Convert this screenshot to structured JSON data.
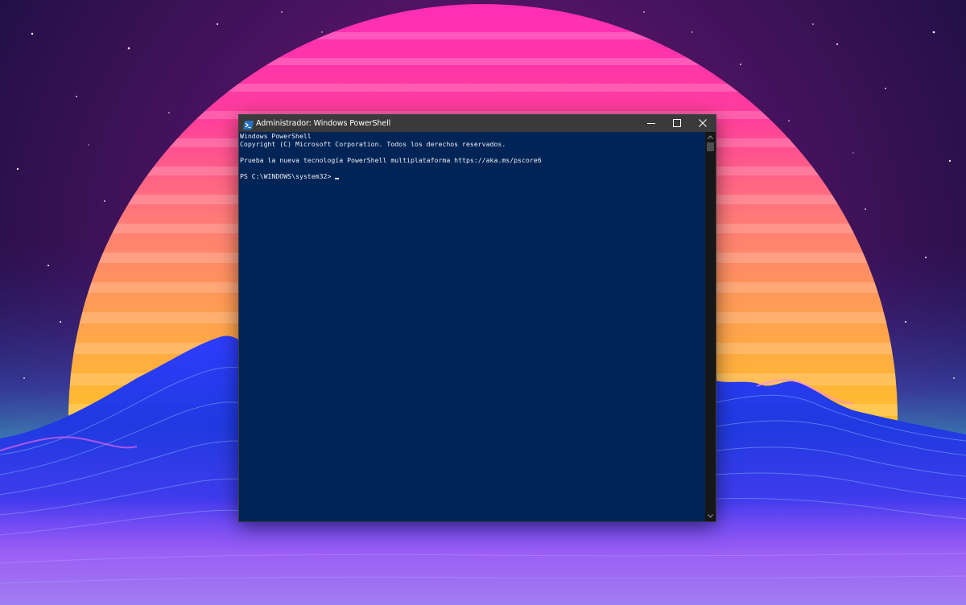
{
  "desktop": {
    "wallpaper": "retrowave-sunset-mountains",
    "colors": {
      "sky_top": "#3c0b50",
      "sky_bottom": "#1a2a8a",
      "sun_top": "#ff3aa8",
      "sun_mid": "#ff8c6a",
      "sun_bottom": "#ffb12e",
      "mountain_blue": "#2a4cff",
      "mountain_pink": "#e85cf0"
    }
  },
  "window": {
    "title": "Administrador: Windows PowerShell",
    "icon": "powershell-icon",
    "controls": {
      "minimize_icon": "minimize-icon",
      "maximize_icon": "maximize-icon",
      "close_icon": "close-icon"
    },
    "colors": {
      "titlebar": "#3a3a3a",
      "console_background": "#012456",
      "console_text": "#eeedf0",
      "scrollbar": "#171717"
    }
  },
  "console": {
    "lines": [
      "Windows PowerShell",
      "Copyright (C) Microsoft Corporation. Todos los derechos reservados.",
      "",
      "Prueba la nueva tecnología PowerShell multiplataforma https://aka.ms/pscore6",
      "",
      "PS C:\\WINDOWS\\system32>"
    ]
  },
  "scrollbar": {
    "up_icon": "chevron-up-icon",
    "down_icon": "chevron-down-icon"
  }
}
